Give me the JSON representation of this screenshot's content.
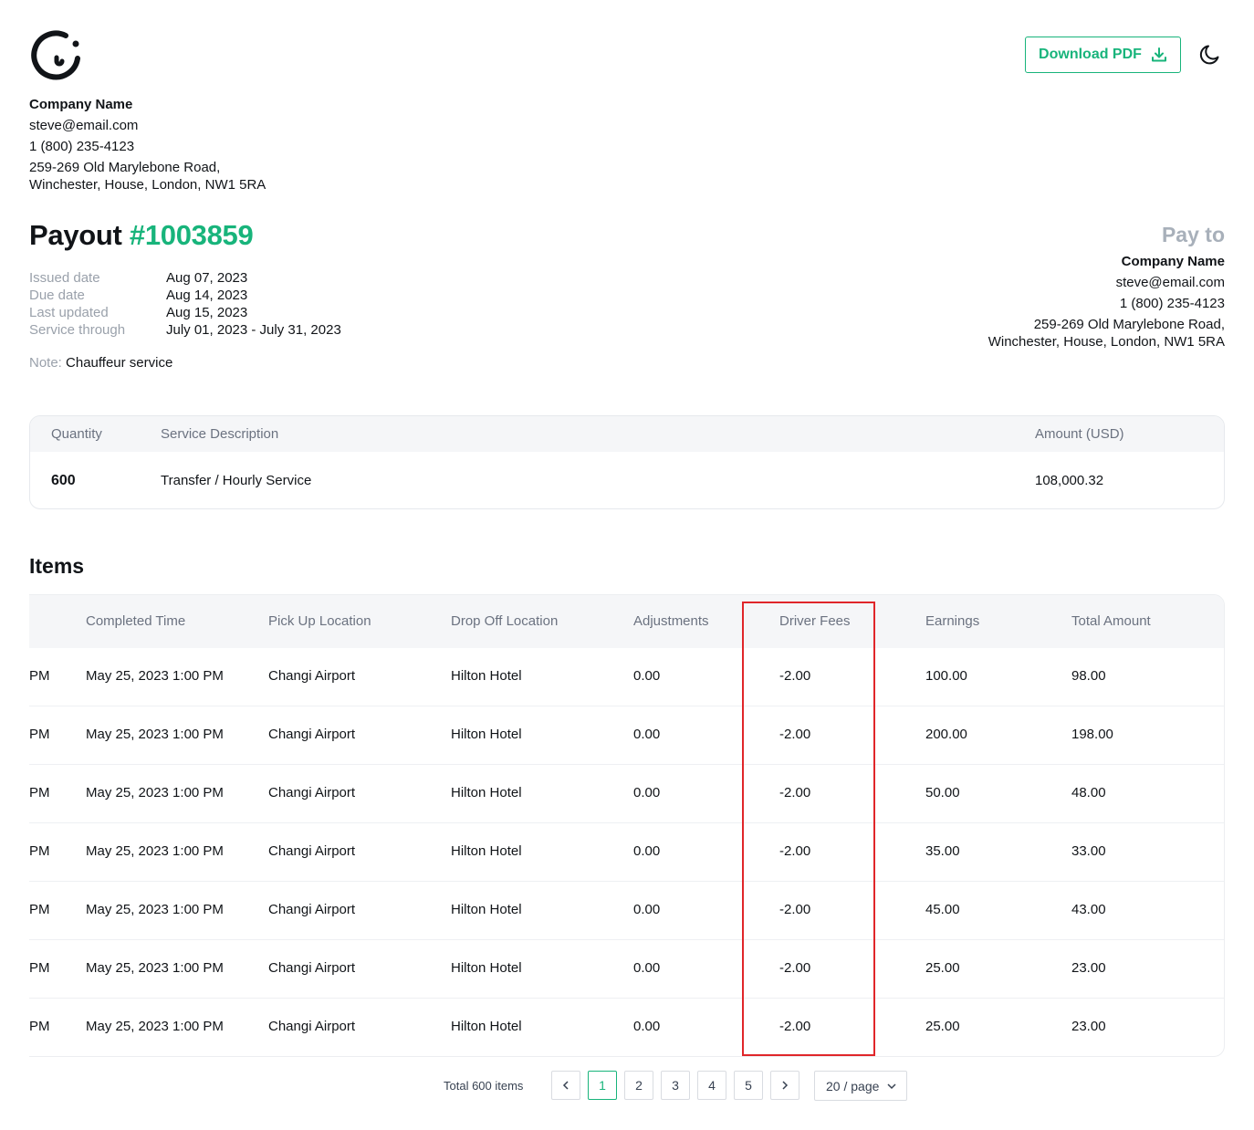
{
  "header": {
    "download_label": "Download PDF"
  },
  "sender": {
    "name": "Company Name",
    "email": "steve@email.com",
    "phone": "1 (800) 235-4123",
    "address_line1": "259-269 Old Marylebone Road,",
    "address_line2": "Winchester, House, London, NW1 5RA"
  },
  "payout": {
    "label": "Payout",
    "number": "#1003859",
    "meta": [
      {
        "label": "Issued date",
        "value": "Aug 07, 2023"
      },
      {
        "label": "Due date",
        "value": "Aug 14, 2023"
      },
      {
        "label": "Last updated",
        "value": "Aug 15, 2023"
      },
      {
        "label": "Service through",
        "value": "July 01, 2023 - July 31, 2023"
      }
    ],
    "note_label": "Note:",
    "note_value": "Chauffeur service"
  },
  "pay_to": {
    "heading": "Pay to",
    "name": "Company Name",
    "email": "steve@email.com",
    "phone": "1 (800) 235-4123",
    "address_line1": "259-269 Old Marylebone Road,",
    "address_line2": "Winchester, House, London, NW1 5RA"
  },
  "summary": {
    "headers": {
      "quantity": "Quantity",
      "description": "Service Description",
      "amount": "Amount (USD)"
    },
    "row": {
      "quantity": "600",
      "description": "Transfer / Hourly Service",
      "amount": "108,000.32"
    }
  },
  "items": {
    "title": "Items",
    "headers": [
      "Completed Time",
      "Pick Up Location",
      "Drop Off Location",
      "Adjustments",
      "Driver Fees",
      "Earnings",
      "Total Amount"
    ],
    "rows": [
      {
        "prefix": "PM",
        "completed": "May 25, 2023 1:00 PM",
        "pickup": "Changi Airport",
        "dropoff": "Hilton Hotel",
        "adjustments": "0.00",
        "driver_fees": "-2.00",
        "earnings": "100.00",
        "total": "98.00"
      },
      {
        "prefix": "PM",
        "completed": "May 25, 2023 1:00 PM",
        "pickup": "Changi Airport",
        "dropoff": "Hilton Hotel",
        "adjustments": "0.00",
        "driver_fees": "-2.00",
        "earnings": "200.00",
        "total": "198.00"
      },
      {
        "prefix": "PM",
        "completed": "May 25, 2023 1:00 PM",
        "pickup": "Changi Airport",
        "dropoff": "Hilton Hotel",
        "adjustments": "0.00",
        "driver_fees": "-2.00",
        "earnings": "50.00",
        "total": "48.00"
      },
      {
        "prefix": "PM",
        "completed": "May 25, 2023 1:00 PM",
        "pickup": "Changi Airport",
        "dropoff": "Hilton Hotel",
        "adjustments": "0.00",
        "driver_fees": "-2.00",
        "earnings": "35.00",
        "total": "33.00"
      },
      {
        "prefix": "PM",
        "completed": "May 25, 2023 1:00 PM",
        "pickup": "Changi Airport",
        "dropoff": "Hilton Hotel",
        "adjustments": "0.00",
        "driver_fees": "-2.00",
        "earnings": "45.00",
        "total": "43.00"
      },
      {
        "prefix": "PM",
        "completed": "May 25, 2023 1:00 PM",
        "pickup": "Changi Airport",
        "dropoff": "Hilton Hotel",
        "adjustments": "0.00",
        "driver_fees": "-2.00",
        "earnings": "25.00",
        "total": "23.00"
      },
      {
        "prefix": "PM",
        "completed": "May 25, 2023 1:00 PM",
        "pickup": "Changi Airport",
        "dropoff": "Hilton Hotel",
        "adjustments": "0.00",
        "driver_fees": "-2.00",
        "earnings": "25.00",
        "total": "23.00"
      }
    ]
  },
  "pagination": {
    "total_label": "Total 600 items",
    "pages": [
      "1",
      "2",
      "3",
      "4",
      "5"
    ],
    "current_page": "1",
    "page_size": "20 / page"
  },
  "colors": {
    "accent": "#18b47b",
    "highlight": "#e0262a"
  }
}
